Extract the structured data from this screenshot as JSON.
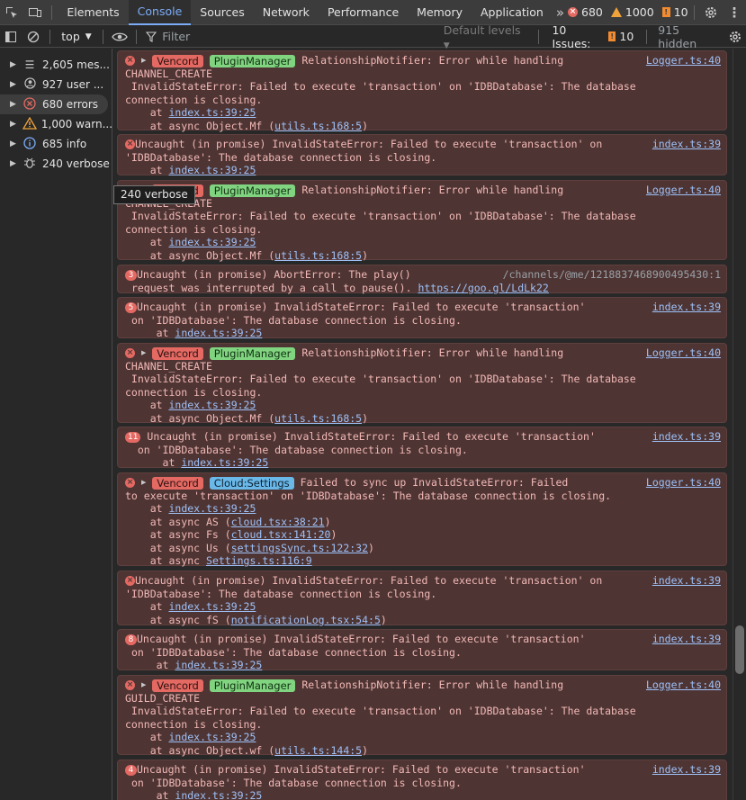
{
  "toolbar": {
    "tabs": [
      "Elements",
      "Console",
      "Sources",
      "Network",
      "Performance",
      "Memory",
      "Application"
    ],
    "active_tab": "Console",
    "more_tabs": "»",
    "errors_count": "680",
    "warnings_count": "1000",
    "issues_count": "10"
  },
  "console_toolbar": {
    "context": "top",
    "filter_placeholder": "Filter",
    "levels": "Default levels",
    "issues_label": "10 Issues:",
    "issues_count": "10",
    "hidden": "915 hidden"
  },
  "sidebar": {
    "items": [
      {
        "label": "2,605 mes...",
        "icon": "list-icon"
      },
      {
        "label": "927 user ...",
        "icon": "user-icon"
      },
      {
        "label": "680 errors",
        "icon": "error-icon"
      },
      {
        "label": "1,000 warn...",
        "icon": "warning-icon"
      },
      {
        "label": "685 info",
        "icon": "info-icon"
      },
      {
        "label": "240 verbose",
        "icon": "bug-icon"
      }
    ],
    "selected": "680 errors",
    "tooltip": "240 verbose"
  },
  "messages": {
    "e1": {
      "tag1": "Vencord",
      "tag2": "PluginManager",
      "l1": "RelationshipNotifier: Error while handling",
      "src": "Logger.ts:40",
      "l2": "CHANNEL_CREATE",
      "l3": " InvalidStateError: Failed to execute 'transaction' on 'IDBDatabase': The database",
      "l4": "connection is closing.",
      "at1": "index.ts:39:25",
      "at2": "utils.ts:168:5"
    },
    "e2": {
      "l1": "Uncaught (in promise) InvalidStateError: Failed to execute 'transaction' on",
      "src": "index.ts:39",
      "l2": "'IDBDatabase': The database connection is closing.",
      "at1": "index.ts:39:25"
    },
    "e3": {
      "tag1": "Vencord",
      "tag2": "PluginManager",
      "l1": "RelationshipNotifier: Error while handling",
      "src": "Logger.ts:40",
      "l2": "CHANNEL_CREATE",
      "l3": " InvalidStateError: Failed to execute 'transaction' on 'IDBDatabase': The database",
      "l4": "connection is closing.",
      "at1": "index.ts:39:25",
      "at2": "utils.ts:168:5"
    },
    "e4": {
      "count": "3",
      "l1": "Uncaught (in promise) AbortError: The play()",
      "src": "/channels/@me/1218837468900495430:1",
      "l2": "request was interrupted by a call to pause().",
      "url": "https://goo.gl/LdLk22"
    },
    "e5": {
      "count": "5",
      "l1": "Uncaught (in promise) InvalidStateError: Failed to execute 'transaction'",
      "src": "index.ts:39",
      "l2": "on 'IDBDatabase': The database connection is closing.",
      "at1": "index.ts:39:25"
    },
    "e6": {
      "tag1": "Vencord",
      "tag2": "PluginManager",
      "l1": "RelationshipNotifier: Error while handling",
      "src": "Logger.ts:40",
      "l2": "CHANNEL_CREATE",
      "l3": " InvalidStateError: Failed to execute 'transaction' on 'IDBDatabase': The database",
      "l4": "connection is closing.",
      "at1": "index.ts:39:25",
      "at2": "utils.ts:168:5"
    },
    "e7": {
      "count": "11",
      "l1": "Uncaught (in promise) InvalidStateError: Failed to execute 'transaction'",
      "src": "index.ts:39",
      "l2": "on 'IDBDatabase': The database connection is closing.",
      "at1": "index.ts:39:25"
    },
    "e8": {
      "tag1": "Vencord",
      "tag2": "Cloud:Settings",
      "l1": "Failed to sync up InvalidStateError: Failed",
      "src": "Logger.ts:40",
      "l2": "to execute 'transaction' on 'IDBDatabase': The database connection is closing.",
      "at1": "index.ts:39:25",
      "as1": "cloud.tsx:38:21",
      "as2": "cloud.tsx:141:20",
      "as3": "settingsSync.ts:122:32",
      "as4": "Settings.ts:116:9"
    },
    "e9": {
      "l1": "Uncaught (in promise) InvalidStateError: Failed to execute 'transaction' on",
      "src": "index.ts:39",
      "l2": "'IDBDatabase': The database connection is closing.",
      "at1": "index.ts:39:25",
      "at2": "notificationLog.tsx:54:5"
    },
    "e10": {
      "count": "8",
      "l1": "Uncaught (in promise) InvalidStateError: Failed to execute 'transaction'",
      "src": "index.ts:39",
      "l2": "on 'IDBDatabase': The database connection is closing.",
      "at1": "index.ts:39:25"
    },
    "e11": {
      "tag1": "Vencord",
      "tag2": "PluginManager",
      "l1": "RelationshipNotifier: Error while handling",
      "src": "Logger.ts:40",
      "l2": "GUILD_CREATE",
      "l3": " InvalidStateError: Failed to execute 'transaction' on 'IDBDatabase': The database",
      "l4": "connection is closing.",
      "at1": "index.ts:39:25",
      "at2": "utils.ts:144:5"
    },
    "e12": {
      "count": "4",
      "l1": "Uncaught (in promise) InvalidStateError: Failed to execute 'transaction'",
      "src": "index.ts:39",
      "l2": "on 'IDBDatabase': The database connection is closing.",
      "at1": "index.ts:39:25"
    }
  }
}
